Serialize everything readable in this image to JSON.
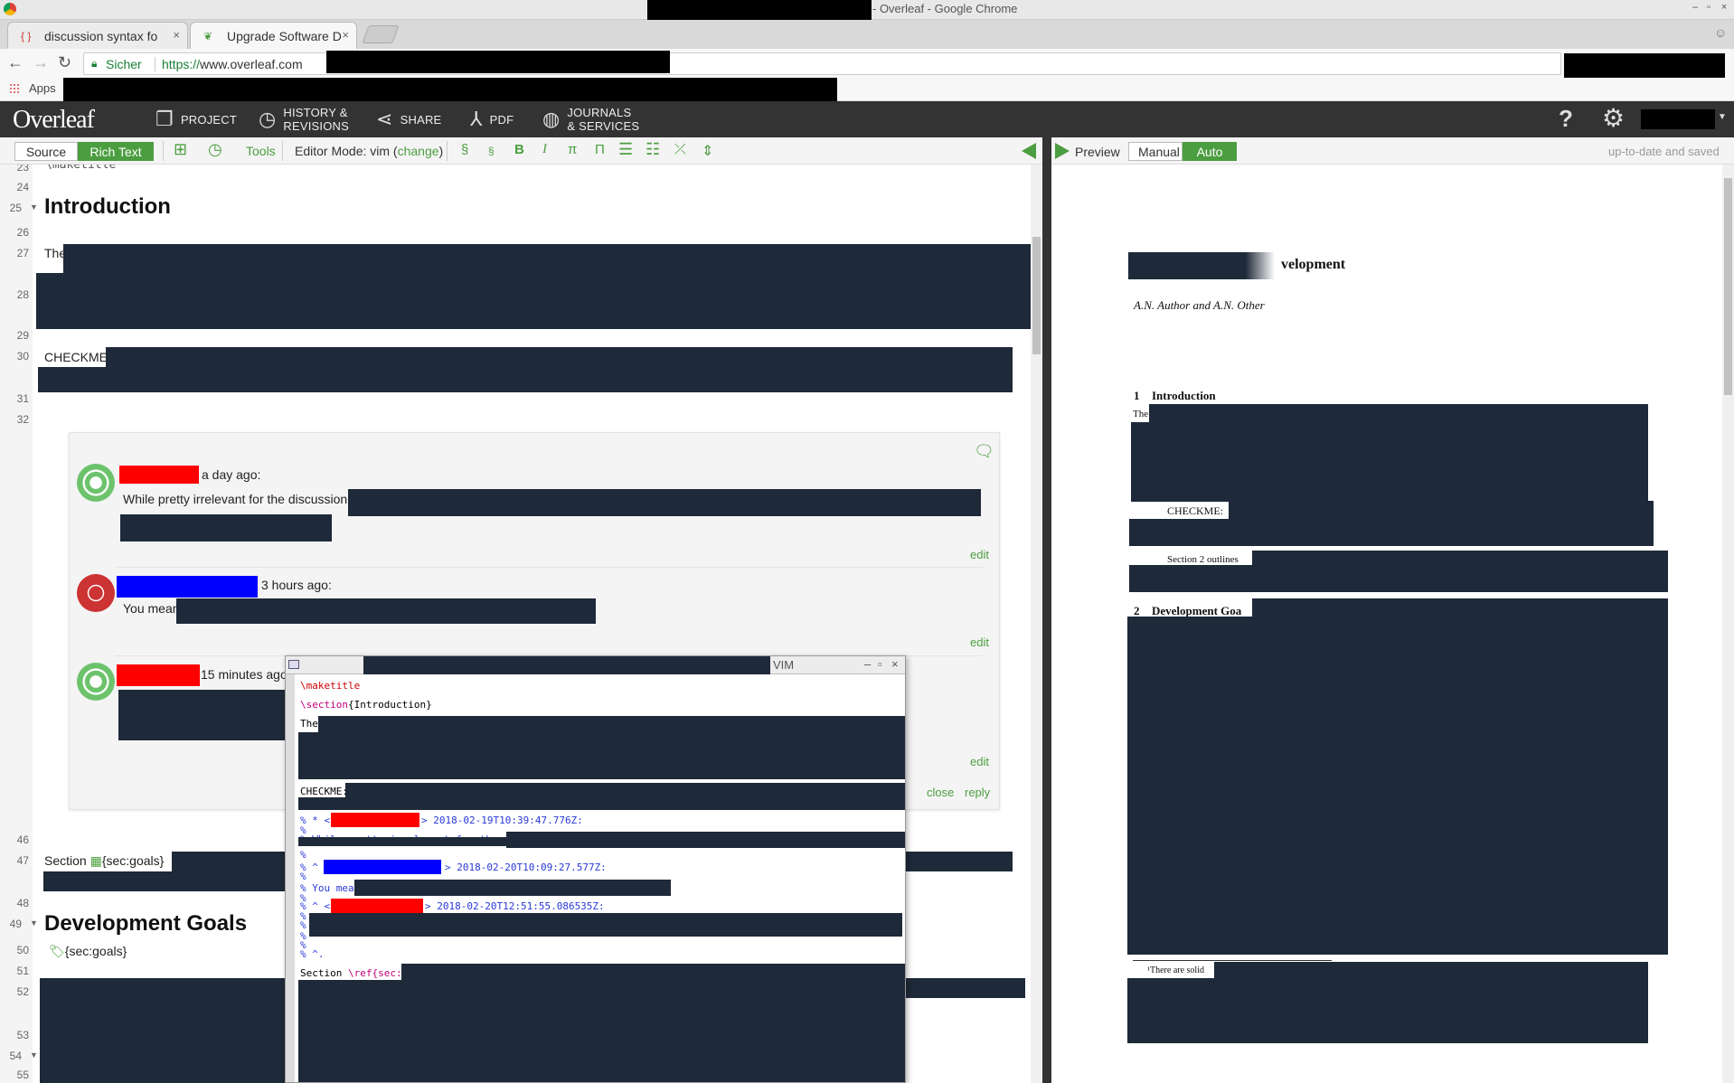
{
  "window": {
    "title": "- Overleaf - Google Chrome"
  },
  "tabs": [
    {
      "label": "discussion syntax fo",
      "favicon": "overleaf-brace-icon",
      "close": "×"
    },
    {
      "label": "Upgrade Software D",
      "favicon": "overleaf-leaf-icon",
      "close": "×"
    }
  ],
  "address": {
    "security_label": "Sicher",
    "url_scheme": "https://",
    "url_host": "www.overleaf.com"
  },
  "bookmarks": {
    "apps_label": "Apps"
  },
  "overleaf_toolbar": {
    "logo": "Overleaf",
    "project": "PROJECT",
    "history_line1": "HISTORY &",
    "history_line2": "REVISIONS",
    "share": "SHARE",
    "pdf": "PDF",
    "journals_line1": "JOURNALS",
    "journals_line2": "& SERVICES",
    "help": "?"
  },
  "editor_toolbar": {
    "source": "Source",
    "rich_text": "Rich Text",
    "tools": "Tools",
    "mode_prefix": "Editor Mode: vim (",
    "mode_change": "change",
    "mode_suffix": ")",
    "section": "§",
    "subsection": "§",
    "bold": "B",
    "italic": "I",
    "math": "π",
    "display_math": "Π"
  },
  "preview_toolbar": {
    "preview": "Preview",
    "manual": "Manual",
    "auto": "Auto",
    "status": "up-to-date and saved"
  },
  "editor": {
    "line_numbers": [
      "23",
      "24",
      "25",
      "26",
      "27",
      "28",
      "29",
      "30",
      "31",
      "32",
      "46",
      "47",
      "48",
      "49",
      "50",
      "51",
      "52",
      "53",
      "54",
      "55"
    ],
    "maketitle": "\\maketitle",
    "intro_heading": "Introduction",
    "line27_start": "The",
    "checkme": "CHECKME:",
    "section_ref_prefix": "Section",
    "section_ref_label": "{sec:goals}",
    "dev_heading": "Development Goals",
    "dev_label": "{sec:goals}"
  },
  "comments": [
    {
      "time": "a day ago:",
      "body": "While pretty irrelevant for the discussion",
      "action": "edit"
    },
    {
      "time": "3 hours ago:",
      "body": "You mean",
      "action": "edit"
    },
    {
      "time": "15 minutes ago",
      "body": "",
      "action": "edit"
    }
  ],
  "comment_actions": {
    "close": "close",
    "reply": "reply"
  },
  "vim": {
    "title": "VIM",
    "lines": {
      "maketitle": "\\maketitle",
      "section_cmd": "\\section",
      "section_arg": "{Introduction}",
      "the": "The",
      "checkme": "CHECKME:",
      "c1_prefix": "% * <",
      "c1_suffix": "> 2018-02-19T10:39:47.776Z:",
      "pct": "%",
      "c1_body_prefix": "% ",
      "c1_body": "While pretty irrelevant for the discussion",
      "c2_prefix": "% ^ ",
      "c2_suffix": "> 2018-02-20T10:09:27.577Z:",
      "c2_body": "% You mean",
      "c3_prefix": "% ^ <",
      "c3_suffix": "> 2018-02-20T12:51:55.086535Z:",
      "end": "% ^.",
      "section_text": "Section ",
      "ref_cmd": "\\ref",
      "ref_arg": "{sec:goals}"
    }
  },
  "preview": {
    "title_fragment": "velopment",
    "authors": "A.N. Author and A.N. Other",
    "sec1_num": "1",
    "sec1_title": "Introduction",
    "sec1_start": "The",
    "checkme": "CHECKME:",
    "section2_outlines": "Section 2 outlines",
    "sec2_num": "2",
    "sec2_title": "Development Goa",
    "footnote": "¹There are solid"
  },
  "colors": {
    "overleaf_green": "#4b9e3f",
    "toolbar_dark": "#333333",
    "redaction": "#1e2939"
  }
}
